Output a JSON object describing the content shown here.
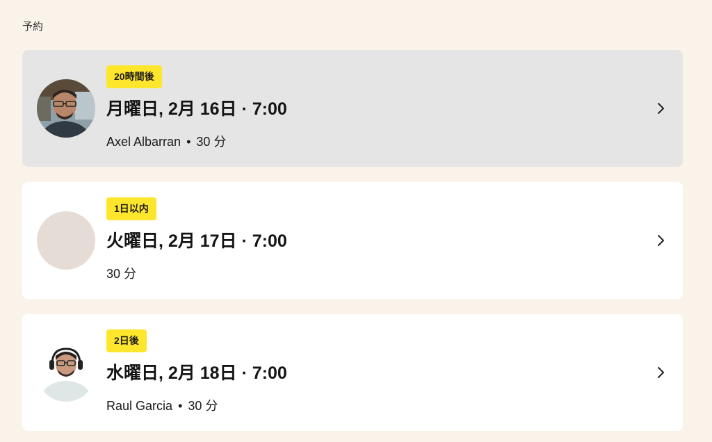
{
  "section": {
    "title": "予約"
  },
  "appointments": [
    {
      "badge": "20時間後",
      "datetime": "月曜日, 2月 16日 · 7:00",
      "name": "Axel Albarran",
      "separator": "•",
      "duration": "30 分",
      "avatar": "photo"
    },
    {
      "badge": "1日以内",
      "datetime": "火曜日, 2月 17日 · 7:00",
      "name": "",
      "separator": "",
      "duration": "30 分",
      "avatar": "placeholder"
    },
    {
      "badge": "2日後",
      "datetime": "水曜日, 2月 18日 · 7:00",
      "name": "Raul Garcia",
      "separator": "•",
      "duration": "30 分",
      "avatar": "photo"
    }
  ],
  "icons": {
    "chevron": "chevron-right-icon"
  },
  "colors": {
    "page_background": "#faf3ea",
    "card_background": "#ffffff",
    "card_active_background": "#e5e5e5",
    "badge_background": "#fde62c",
    "placeholder_avatar": "#e5ddd5"
  }
}
